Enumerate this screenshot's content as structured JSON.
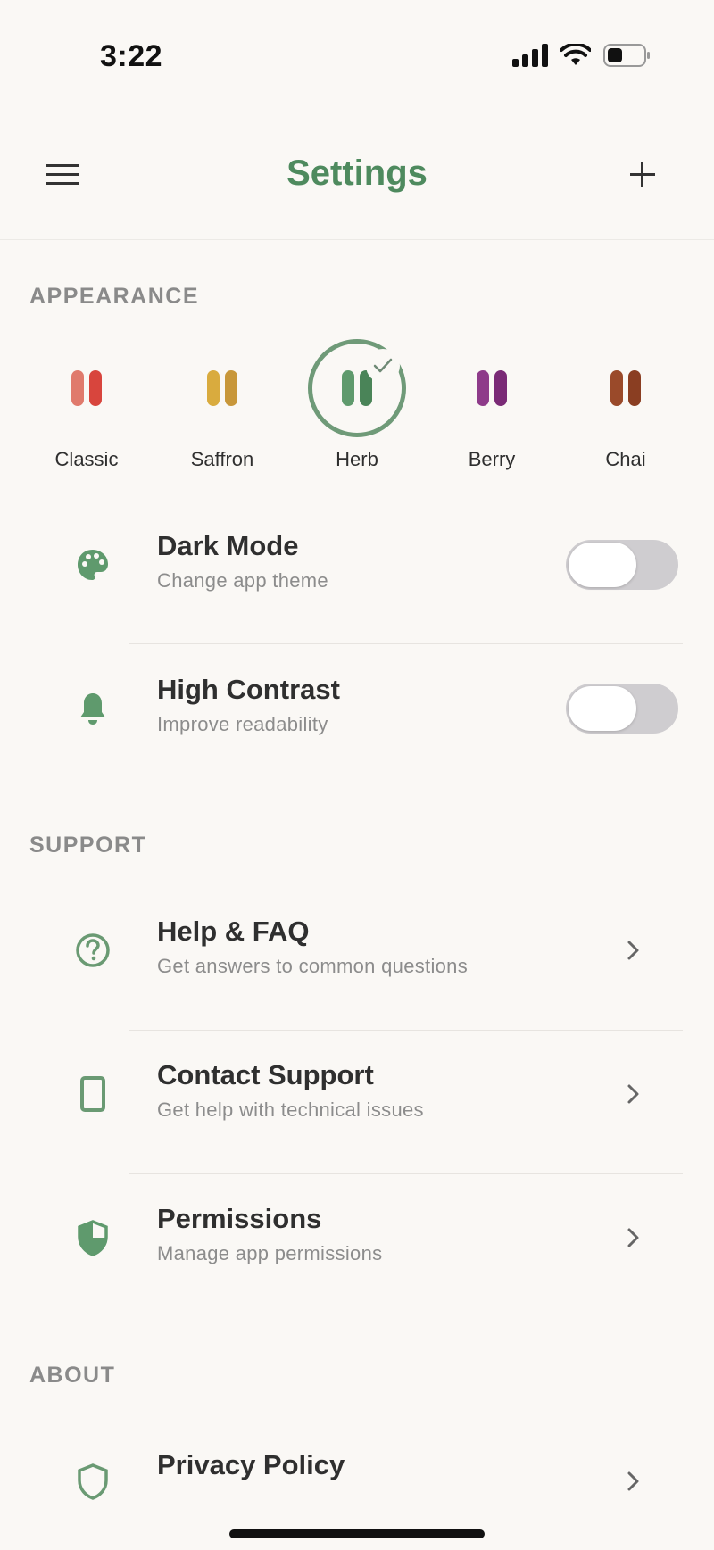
{
  "status": {
    "time": "3:22"
  },
  "header": {
    "title": "Settings"
  },
  "appearance": {
    "label": "APPEARANCE",
    "themes": [
      {
        "name": "Classic",
        "colors": [
          "#e07a6c",
          "#d8453d"
        ],
        "selected": false
      },
      {
        "name": "Saffron",
        "colors": [
          "#d9ab3e",
          "#c8973a"
        ],
        "selected": false
      },
      {
        "name": "Herb",
        "colors": [
          "#5f9a6d",
          "#4a8458"
        ],
        "selected": true
      },
      {
        "name": "Berry",
        "colors": [
          "#8e3b8a",
          "#7a2a76"
        ],
        "selected": false
      },
      {
        "name": "Chai",
        "colors": [
          "#9a4a2a",
          "#8a3e22"
        ],
        "selected": false
      }
    ],
    "rows": [
      {
        "title": "Dark Mode",
        "subtitle": "Change app theme",
        "icon": "palette-icon",
        "enabled": false
      },
      {
        "title": "High Contrast",
        "subtitle": "Improve readability",
        "icon": "bell-icon",
        "enabled": false
      }
    ]
  },
  "support": {
    "label": "SUPPORT",
    "rows": [
      {
        "title": "Help & FAQ",
        "subtitle": "Get answers to common questions",
        "icon": "help-circle-icon"
      },
      {
        "title": "Contact Support",
        "subtitle": "Get help with technical issues",
        "icon": "phone-icon"
      },
      {
        "title": "Permissions",
        "subtitle": "Manage app permissions",
        "icon": "shield-half-icon"
      }
    ]
  },
  "about": {
    "label": "ABOUT",
    "rows": [
      {
        "title": "Privacy Policy",
        "icon": "shield-outline-icon"
      }
    ]
  },
  "colors": {
    "accent": "#4e8a5e",
    "icon": "#6a9a73"
  }
}
